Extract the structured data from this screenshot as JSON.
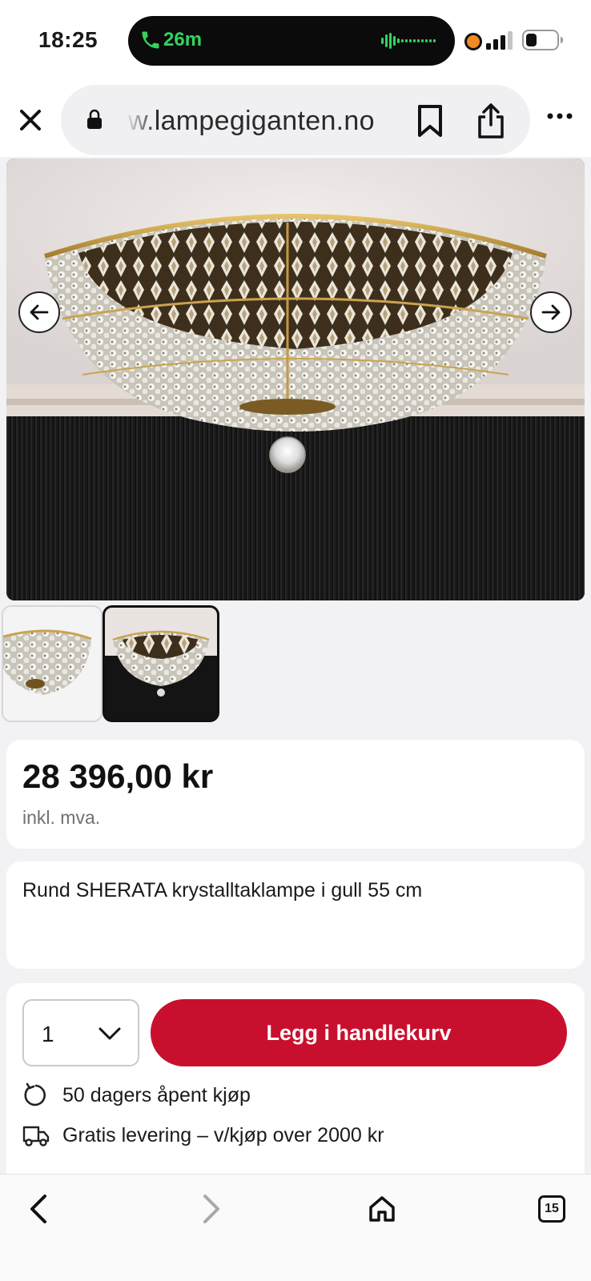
{
  "status_bar": {
    "time": "18:25",
    "call_duration": "26m",
    "colors": {
      "call_green": "#33d35e",
      "record_dot": "#f08a24"
    },
    "icons": [
      "phone-icon",
      "waveform-icon",
      "recording-dot-icon",
      "signal-icon",
      "battery-icon"
    ]
  },
  "browser": {
    "url": "w.lampegiganten.no",
    "icons": [
      "close-icon",
      "lock-icon",
      "bookmark-icon",
      "share-icon",
      "more-icon"
    ]
  },
  "gallery": {
    "image_alt": "Rund SHERATA krystalltaklampe i gull",
    "prev_icon": "arrow-left-icon",
    "next_icon": "arrow-right-icon",
    "thumbnail_count": 2,
    "selected_thumbnail": 2
  },
  "price_card": {
    "price": "28 396,00 kr",
    "vat_note": "inkl. mva."
  },
  "product": {
    "title": "Rund SHERATA krystalltaklampe i gull 55 cm"
  },
  "cart": {
    "quantity": "1",
    "add_button_label": "Legg i handlekurv",
    "accent_color": "#c8102e",
    "perks": [
      {
        "icon": "refresh-icon",
        "text": "50 dagers åpent kjøp"
      },
      {
        "icon": "truck-icon",
        "text": "Gratis levering – v/kjøp over 2000 kr"
      }
    ]
  },
  "bottom_nav": {
    "tab_count": "15",
    "icons": [
      "back-icon",
      "forward-icon",
      "home-icon",
      "tabs-icon"
    ]
  }
}
